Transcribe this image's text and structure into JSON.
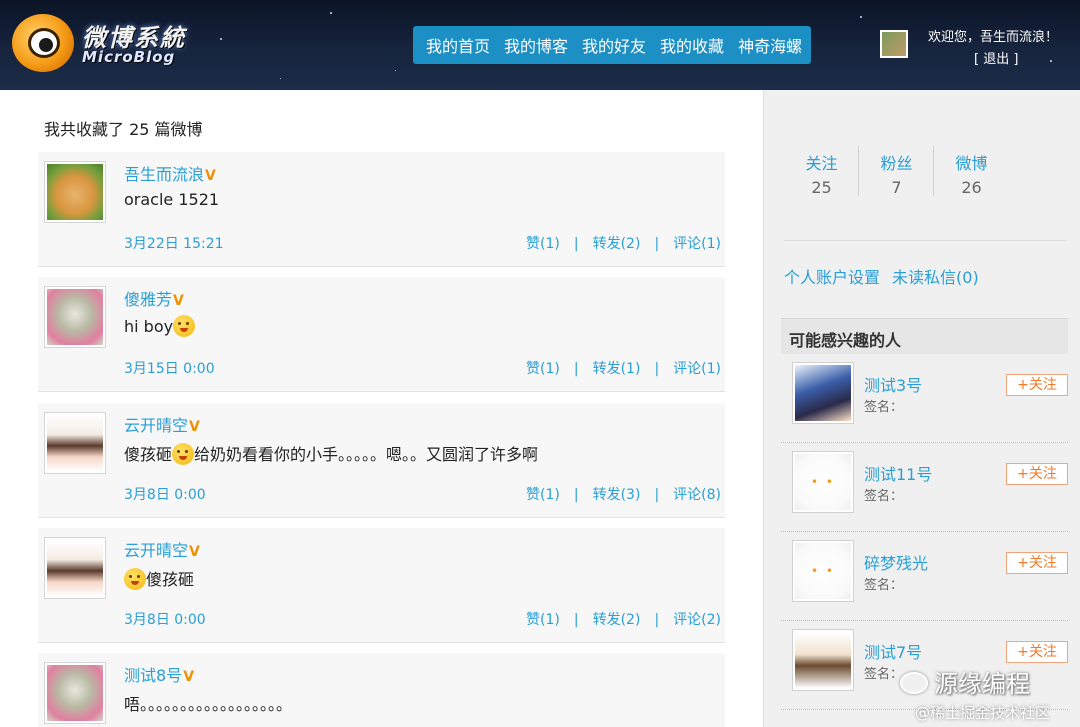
{
  "header": {
    "logo_title": "微博系統",
    "logo_sub": "MicroBlog",
    "nav": [
      "我的首页",
      "我的博客",
      "我的好友",
      "我的收藏",
      "神奇海螺"
    ],
    "welcome": "欢迎您，吾生而流浪！",
    "logout": "[ 退出 ]"
  },
  "main": {
    "fav_count": "我共收藏了 25 篇微博",
    "posts": [
      {
        "user": "吾生而流浪",
        "vip": "V",
        "content": "oracle 1521",
        "time": "3月22日 15:21",
        "like": "赞(1)",
        "repost": "转发(2)",
        "comment": "评论(1)",
        "sep": "|"
      },
      {
        "user": "傻雅芳",
        "vip": "V",
        "content": "hi boy",
        "time": "3月15日 0:00",
        "like": "赞(1)",
        "repost": "转发(1)",
        "comment": "评论(1)",
        "sep": "|"
      },
      {
        "user": "云开晴空",
        "vip": "V",
        "content_a": "傻孩砸",
        "content_b": "给奶奶看看你的小手。。。。。嗯。。又圆润了许多啊",
        "time": "3月8日 0:00",
        "like": "赞(1)",
        "repost": "转发(3)",
        "comment": "评论(8)",
        "sep": "|"
      },
      {
        "user": "云开晴空",
        "vip": "V",
        "content": "傻孩砸",
        "time": "3月8日 0:00",
        "like": "赞(1)",
        "repost": "转发(2)",
        "comment": "评论(2)",
        "sep": "|"
      },
      {
        "user": "测试8号",
        "vip": "V",
        "content": "唔。。。。。。。。。。。。。。。。。。"
      }
    ]
  },
  "sidebar": {
    "stats": [
      {
        "label": "关注",
        "value": "25"
      },
      {
        "label": "粉丝",
        "value": "7"
      },
      {
        "label": "微博",
        "value": "26"
      }
    ],
    "links": [
      "个人账户设置",
      "未读私信(0)"
    ],
    "rec_title": "可能感兴趣的人",
    "recommend": [
      {
        "name": "测试3号",
        "sign": "签名：",
        "follow": "+关注"
      },
      {
        "name": "测试11号",
        "sign": "签名：",
        "follow": "+关注"
      },
      {
        "name": "碎梦残光",
        "sign": "签名：",
        "follow": "+关注"
      },
      {
        "name": "测试7号",
        "sign": "签名：",
        "follow": "+关注"
      }
    ]
  },
  "watermark": {
    "line1": "源缘编程",
    "line2": "@稀土掘金技术社区"
  }
}
